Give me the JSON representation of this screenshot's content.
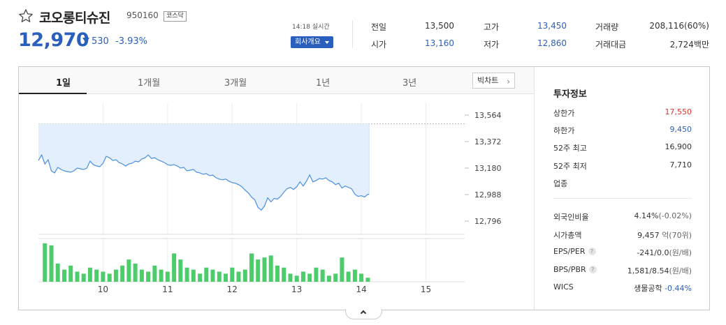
{
  "stock": {
    "name": "코오롱티슈진",
    "code": "950160",
    "market": "코스닥",
    "price": "12,970",
    "change_amount": "530",
    "change_percent": "-3.93%",
    "direction": "down"
  },
  "realtime": {
    "time": "14:18 실시간",
    "company_button": "회사개요"
  },
  "quote": {
    "prev_close_label": "전일",
    "prev_close": "13,500",
    "open_label": "시가",
    "open": "13,160",
    "high_label": "고가",
    "high": "13,450",
    "low_label": "저가",
    "low": "12,860",
    "volume_label": "거래량",
    "volume": "208,116(60%)",
    "turnover_label": "거래대금",
    "turnover": "2,724백만"
  },
  "tabs": [
    {
      "label": "1일",
      "active": true
    },
    {
      "label": "1개월",
      "active": false
    },
    {
      "label": "3개월",
      "active": false
    },
    {
      "label": "1년",
      "active": false
    },
    {
      "label": "3년",
      "active": false
    }
  ],
  "bigchart_label": "빅차트",
  "chart_data": {
    "type": "area",
    "prev_close": 13500,
    "y_ticks": [
      "13,564",
      "13,372",
      "13,180",
      "12,988",
      "12,796"
    ],
    "y_tick_values": [
      13564,
      13372,
      13180,
      12988,
      12796
    ],
    "ylim": [
      12700,
      13650
    ],
    "x_ticks": [
      "10",
      "11",
      "12",
      "13",
      "14",
      "15"
    ],
    "x_tick_values": [
      10,
      11,
      12,
      13,
      14,
      15
    ],
    "xlim": [
      9,
      15.6
    ],
    "price_series": [
      [
        9.0,
        13235
      ],
      [
        9.05,
        13275
      ],
      [
        9.1,
        13210
      ],
      [
        9.15,
        13240
      ],
      [
        9.2,
        13160
      ],
      [
        9.25,
        13145
      ],
      [
        9.3,
        13185
      ],
      [
        9.35,
        13170
      ],
      [
        9.4,
        13160
      ],
      [
        9.45,
        13155
      ],
      [
        9.5,
        13150
      ],
      [
        9.55,
        13160
      ],
      [
        9.6,
        13180
      ],
      [
        9.65,
        13175
      ],
      [
        9.7,
        13170
      ],
      [
        9.75,
        13180
      ],
      [
        9.8,
        13230
      ],
      [
        9.85,
        13205
      ],
      [
        9.9,
        13195
      ],
      [
        9.95,
        13190
      ],
      [
        10.0,
        13215
      ],
      [
        10.05,
        13265
      ],
      [
        10.1,
        13255
      ],
      [
        10.15,
        13235
      ],
      [
        10.2,
        13240
      ],
      [
        10.25,
        13220
      ],
      [
        10.3,
        13210
      ],
      [
        10.35,
        13195
      ],
      [
        10.4,
        13210
      ],
      [
        10.45,
        13215
      ],
      [
        10.5,
        13230
      ],
      [
        10.55,
        13225
      ],
      [
        10.6,
        13245
      ],
      [
        10.65,
        13255
      ],
      [
        10.7,
        13275
      ],
      [
        10.75,
        13250
      ],
      [
        10.8,
        13255
      ],
      [
        10.85,
        13240
      ],
      [
        10.9,
        13230
      ],
      [
        10.95,
        13220
      ],
      [
        11.0,
        13205
      ],
      [
        11.05,
        13200
      ],
      [
        11.1,
        13205
      ],
      [
        11.15,
        13195
      ],
      [
        11.2,
        13180
      ],
      [
        11.25,
        13185
      ],
      [
        11.3,
        13160
      ],
      [
        11.35,
        13165
      ],
      [
        11.4,
        13170
      ],
      [
        11.45,
        13150
      ],
      [
        11.5,
        13145
      ],
      [
        11.55,
        13135
      ],
      [
        11.6,
        13140
      ],
      [
        11.65,
        13125
      ],
      [
        11.7,
        13130
      ],
      [
        11.75,
        13110
      ],
      [
        11.8,
        13100
      ],
      [
        11.85,
        13095
      ],
      [
        11.9,
        13100
      ],
      [
        11.95,
        13085
      ],
      [
        12.0,
        13075
      ],
      [
        12.05,
        13070
      ],
      [
        12.1,
        13060
      ],
      [
        12.15,
        13045
      ],
      [
        12.2,
        13020
      ],
      [
        12.25,
        13000
      ],
      [
        12.3,
        12970
      ],
      [
        12.35,
        12950
      ],
      [
        12.4,
        12895
      ],
      [
        12.45,
        12875
      ],
      [
        12.5,
        12905
      ],
      [
        12.55,
        12965
      ],
      [
        12.6,
        12935
      ],
      [
        12.65,
        12960
      ],
      [
        12.7,
        12955
      ],
      [
        12.75,
        12975
      ],
      [
        12.8,
        13005
      ],
      [
        12.85,
        13030
      ],
      [
        12.9,
        13040
      ],
      [
        12.95,
        13025
      ],
      [
        13.0,
        13045
      ],
      [
        13.05,
        13080
      ],
      [
        13.1,
        13050
      ],
      [
        13.15,
        13085
      ],
      [
        13.2,
        13130
      ],
      [
        13.25,
        13080
      ],
      [
        13.3,
        13090
      ],
      [
        13.35,
        13105
      ],
      [
        13.4,
        13100
      ],
      [
        13.45,
        13110
      ],
      [
        13.5,
        13090
      ],
      [
        13.55,
        13080
      ],
      [
        13.6,
        13060
      ],
      [
        13.65,
        13070
      ],
      [
        13.7,
        13035
      ],
      [
        13.75,
        13050
      ],
      [
        13.8,
        13040
      ],
      [
        13.85,
        13030
      ],
      [
        13.9,
        12990
      ],
      [
        13.95,
        12975
      ],
      [
        14.0,
        12980
      ],
      [
        14.05,
        12970
      ],
      [
        14.1,
        12990
      ],
      [
        14.12,
        12990
      ]
    ],
    "volume_series": [
      [
        9.1,
        95
      ],
      [
        9.2,
        90
      ],
      [
        9.3,
        45
      ],
      [
        9.4,
        30
      ],
      [
        9.5,
        40
      ],
      [
        9.6,
        25
      ],
      [
        9.7,
        20
      ],
      [
        9.8,
        35
      ],
      [
        9.9,
        30
      ],
      [
        10.0,
        25
      ],
      [
        10.1,
        20
      ],
      [
        10.2,
        30
      ],
      [
        10.3,
        40
      ],
      [
        10.4,
        55
      ],
      [
        10.5,
        45
      ],
      [
        10.6,
        30
      ],
      [
        10.7,
        25
      ],
      [
        10.8,
        40
      ],
      [
        10.9,
        30
      ],
      [
        11.0,
        25
      ],
      [
        11.1,
        70
      ],
      [
        11.2,
        55
      ],
      [
        11.3,
        35
      ],
      [
        11.4,
        30
      ],
      [
        11.5,
        20
      ],
      [
        11.6,
        35
      ],
      [
        11.7,
        30
      ],
      [
        11.8,
        25
      ],
      [
        11.9,
        20
      ],
      [
        12.0,
        35
      ],
      [
        12.1,
        25
      ],
      [
        12.2,
        30
      ],
      [
        12.3,
        70
      ],
      [
        12.4,
        55
      ],
      [
        12.5,
        60
      ],
      [
        12.6,
        65
      ],
      [
        12.7,
        40
      ],
      [
        12.8,
        35
      ],
      [
        12.9,
        20
      ],
      [
        13.0,
        15
      ],
      [
        13.1,
        25
      ],
      [
        13.2,
        20
      ],
      [
        13.3,
        35
      ],
      [
        13.4,
        30
      ],
      [
        13.5,
        15
      ],
      [
        13.6,
        20
      ],
      [
        13.7,
        60
      ],
      [
        13.8,
        25
      ],
      [
        13.9,
        30
      ],
      [
        14.0,
        20
      ],
      [
        14.1,
        10
      ]
    ]
  },
  "invest": {
    "title": "투자정보",
    "upper_limit_label": "상한가",
    "upper_limit": "17,550",
    "lower_limit_label": "하한가",
    "lower_limit": "9,450",
    "w52_high_label": "52주 최고",
    "w52_high": "16,900",
    "w52_low_label": "52주 최저",
    "w52_low": "7,710",
    "sector_label": "업종",
    "foreign_label": "외국인비율",
    "foreign_val": "4.14%",
    "foreign_chg": "(-0.02%)",
    "mcap_label": "시가총액",
    "mcap_val": "9,457",
    "mcap_unit": "억(70위)",
    "eps_label": "EPS/PER",
    "eps_val": "-241/0.0",
    "eps_unit": "(원/배)",
    "bps_label": "BPS/PBR",
    "bps_val": "1,581/8.54",
    "bps_unit": "(원/배)",
    "wics_label": "WICS",
    "wics_val": "생물공학",
    "wics_chg": "-0.44%"
  },
  "colors": {
    "accent_blue": "#2b5fbd",
    "line_blue": "#4a8fe0",
    "fill_blue": "#e4effd",
    "volume_green": "#4ccc6a",
    "red": "#e0312c"
  }
}
